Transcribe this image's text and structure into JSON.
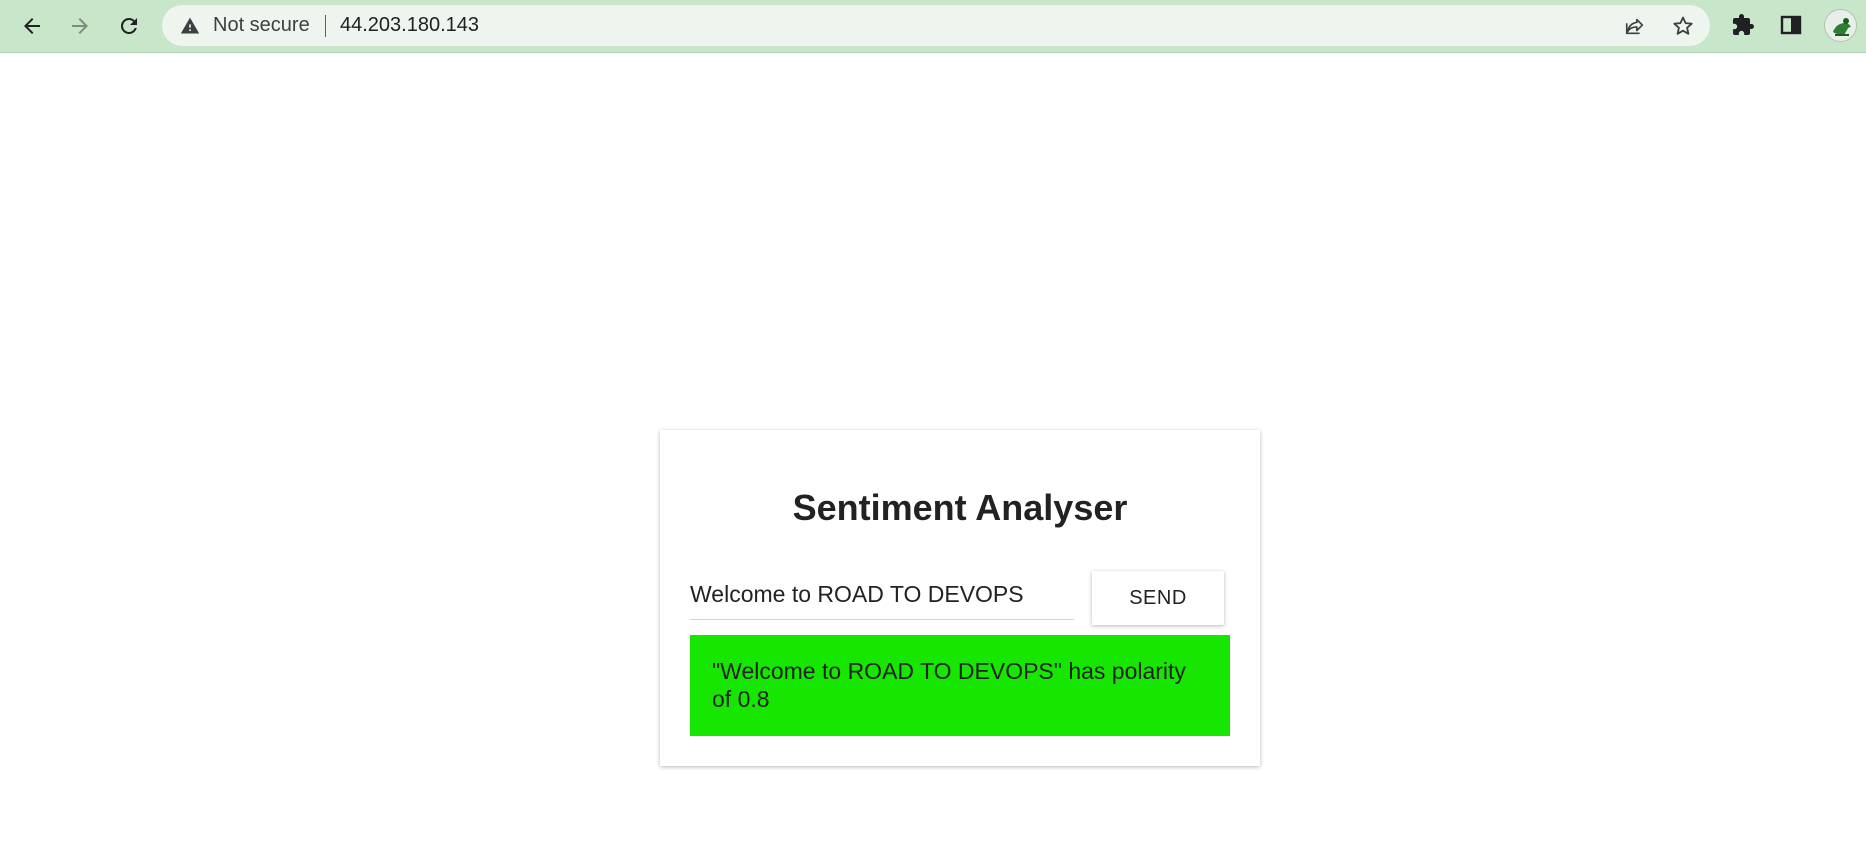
{
  "browser": {
    "security_label": "Not secure",
    "url": "44.203.180.143",
    "icons": {
      "back": "back-arrow-icon",
      "forward": "forward-arrow-icon",
      "reload": "reload-icon",
      "warning": "warning-triangle-icon",
      "share": "share-icon",
      "bookmark": "star-icon",
      "extensions": "puzzle-icon",
      "side_panel": "side-panel-icon",
      "profile": "avatar"
    },
    "theme_color": "#c8e6c9"
  },
  "app": {
    "title": "Sentiment Analyser",
    "input_value": "Welcome to ROAD TO DEVOPS",
    "send_label": "SEND",
    "result_text": "\"Welcome to ROAD TO DEVOPS\" has polarity of 0.8",
    "result_color": "#17e600"
  }
}
